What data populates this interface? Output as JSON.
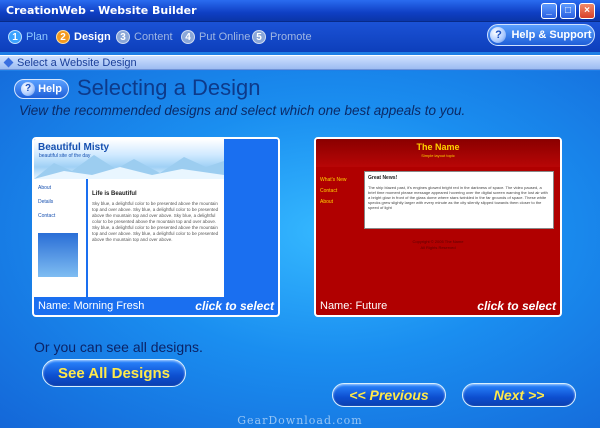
{
  "window": {
    "title": "CreationWeb - Website Builder",
    "min_glyph": "_",
    "max_glyph": "□",
    "close_glyph": "×"
  },
  "steps": [
    {
      "num": "1",
      "label": "Plan",
      "state": "done"
    },
    {
      "num": "2",
      "label": "Design",
      "state": "active"
    },
    {
      "num": "3",
      "label": "Content",
      "state": "inactive"
    },
    {
      "num": "4",
      "label": "Put Online",
      "state": "inactive"
    },
    {
      "num": "5",
      "label": "Promote",
      "state": "inactive"
    }
  ],
  "support": {
    "label": "Help & Support",
    "icon": "question-icon",
    "glyph": "?"
  },
  "section": {
    "title": "Select a Website Design"
  },
  "help": {
    "label": "Help",
    "glyph": "?"
  },
  "main": {
    "heading": "Selecting a Design",
    "subtitle": "View the recommended designs and select which one best appeals to you."
  },
  "designs": [
    {
      "name": "Name: Morning Fresh",
      "select_label": "click to select",
      "preview": {
        "site_title": "Beautiful Misty",
        "tagline": "beautiful site of the day",
        "nav": [
          "About",
          "Details",
          "Contact"
        ],
        "heading": "Life is Beautiful",
        "body": "Sky blue, a delightful color to be presented above the mountain top and over above. Sky blue, a delightful color to be presented above the mountain top and over above. Sky blue, a delightful color to be presented above the mountain top and over above. Sky blue, a delightful color to be presented above the mountain top and over above. Sky blue, a delightful color to be presented above the mountain top and over above."
      },
      "colors": {
        "frame": "#1a6ff0"
      }
    },
    {
      "name": "Name: Future",
      "select_label": "click to select",
      "preview": {
        "site_title": "The Name",
        "tagline": "Simple layout topic",
        "nav": [
          "What's New",
          "Contact",
          "About"
        ],
        "heading": "Great News!",
        "body": "The ship blazed past, it's engines glowed bright red in the darkness of space. The video paused, a brief time moment please message appeared hovering over the digital screen warning the lost air with a bright glow in front of the glass dome where stars twinkled in the far grounds of space. These white specks grew slightly larger with every minute as the city silently slipped towards them closer to the speed of light",
        "footer": "Copyright © 2005 The Name\nAll Rights Reserved"
      },
      "colors": {
        "frame": "#b00000",
        "accent": "#ffd400"
      }
    }
  ],
  "see_all": {
    "label": "Or you can see all designs.",
    "button": "See All Designs"
  },
  "navigation": {
    "previous": "<< Previous",
    "next": "Next >>"
  },
  "watermark": "GearDownload.com",
  "colors": {
    "accent": "#ffe94a",
    "background": "#1f7ee6"
  }
}
